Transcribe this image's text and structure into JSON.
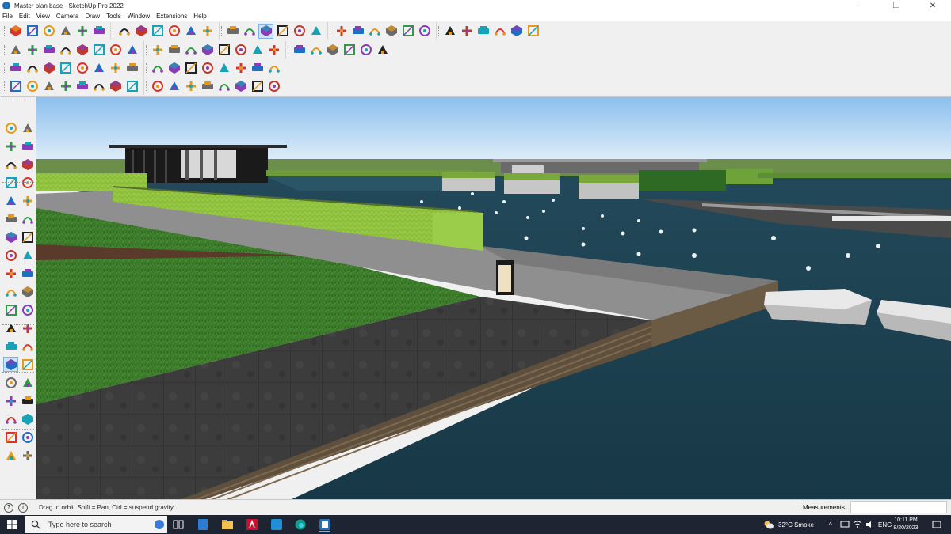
{
  "window": {
    "title": "Master plan base - SketchUp Pro 2022",
    "minimize_glyph": "–",
    "restore_glyph": "❐",
    "close_glyph": "✕"
  },
  "menu": [
    "File",
    "Edit",
    "View",
    "Camera",
    "Draw",
    "Tools",
    "Window",
    "Extensions",
    "Help"
  ],
  "toolbars": {
    "row1_icons": [
      "zoom-icon",
      "select-icon",
      "eraser-icon",
      "line-icon",
      "arc-icon",
      "shape-icon",
      "push-pull-icon",
      "follow-me-icon",
      "move-icon",
      "rotate-icon",
      "scale-icon",
      "tape-measure-icon",
      "text-icon",
      "paint-bucket-icon",
      "orbit-icon",
      "pan-icon",
      "zoom-camera-icon",
      "zoom-extents-icon",
      "warehouse-icon",
      "extension-warehouse-icon",
      "layout-icon",
      "account-icon",
      "section-plane-icon",
      "x-ray-icon",
      "axes-icon",
      "dimensions-icon",
      "sandbox-icon",
      "undo-icon",
      "redo-icon",
      "flip-icon"
    ],
    "row2_icons": [
      "iso-view-icon",
      "top-view-icon",
      "front-view-icon",
      "right-view-icon",
      "back-view-icon",
      "left-view-icon",
      "bottom-view-icon",
      "parallel-icon",
      "perspective-icon",
      "group-icon",
      "component-icon",
      "house-icon",
      "outliner-icon",
      "solid-tools-icon",
      "tag-icon",
      "paint-icon",
      "curve-icon",
      "loop-icon",
      "polygon-icon",
      "shapes-icon",
      "offset-icon",
      "contour-icon"
    ],
    "row3_icons": [
      "style-icon",
      "face-icon",
      "wire-icon",
      "section-icon",
      "hidden-icon",
      "shaded-icon",
      "texture-icon",
      "mono-icon",
      "hide-icon",
      "intersect-icon",
      "union-icon",
      "subtract-icon",
      "trim-icon",
      "split-icon",
      "solid-outer-icon",
      "terrain-icon"
    ],
    "row4_icons": [
      "circle-icon",
      "arc-2pt-icon",
      "pie-icon",
      "polygon-tool-icon",
      "rectangle-icon",
      "rotated-rect-icon",
      "freehand-icon",
      "sweep-icon",
      "stairs-icon",
      "roof-icon",
      "wall-icon",
      "window-icon",
      "door-icon",
      "railing-icon",
      "grid-icon",
      "sun-icon"
    ]
  },
  "left_toolbar_icons": [
    "select-icon",
    "component-icon",
    "paint-bucket-icon",
    "eraser-icon",
    "tag-icon",
    "tape-icon",
    "line-icon",
    "freehand-icon",
    "rectangle-icon",
    "rotated-rect-icon",
    "circle-icon",
    "polygon-icon",
    "arc-icon",
    "arc-2pt-icon",
    "pie-icon",
    "move-icon",
    "push-pull-icon",
    "rotate-icon",
    "follow-me-icon",
    "scale-icon",
    "offset-icon",
    "tape-measure-icon",
    "text-icon",
    "protractor-icon",
    "3d-text-icon",
    "axes-icon",
    "orbit-icon",
    "pan-icon",
    "zoom-icon",
    "zoom-window-icon",
    "zoom-extents-icon",
    "previous-icon",
    "position-camera-icon",
    "walk-icon",
    "look-around-icon",
    "section-plane-icon",
    "sandbox-icon",
    "terrain-icon"
  ],
  "status": {
    "hint": "Drag to orbit. Shift = Pan, Ctrl = suspend gravity.",
    "measurements_label": "Measurements",
    "measurements_value": ""
  },
  "taskbar": {
    "search_placeholder": "Type here to search",
    "weather": "32°C  Smoke",
    "language": "ENG",
    "time": "10:11 PM",
    "date": "8/20/2023"
  },
  "colors": {
    "sky_top": "#8fc2ef",
    "sky_bottom": "#eef6fb",
    "water": "#1f4756",
    "grass": "#3a7a2a",
    "hedge": "#8bbf3a",
    "paving": "#3a3a3a",
    "selected_tool": "#cfe3f7"
  }
}
